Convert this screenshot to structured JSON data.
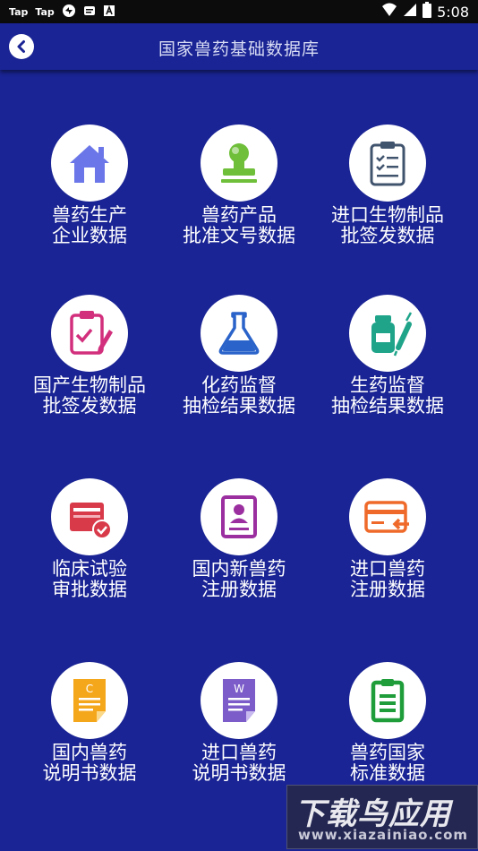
{
  "status_bar": {
    "app1": "Tap",
    "app2": "Tap",
    "time": "5:08"
  },
  "app_bar": {
    "title": "国家兽药基础数据库"
  },
  "tiles": [
    {
      "line1": "兽药生产",
      "line2": "企业数据",
      "icon": "house-icon",
      "color": "#6b77e8"
    },
    {
      "line1": "兽药产品",
      "line2": "批准文号数据",
      "icon": "stamp-icon",
      "color": "#6fbf3a"
    },
    {
      "line1": "进口生物制品",
      "line2": "批签发数据",
      "icon": "clipboard-checklist-icon",
      "color": "#41546e"
    },
    {
      "line1": "国产生物制品",
      "line2": "批签发数据",
      "icon": "clipboard-pen-icon",
      "color": "#d22f7d"
    },
    {
      "line1": "化药监督",
      "line2": "抽检结果数据",
      "icon": "flask-icon",
      "color": "#2a63c9"
    },
    {
      "line1": "生药监督",
      "line2": "抽检结果数据",
      "icon": "vial-syringe-icon",
      "color": "#1fa48a"
    },
    {
      "line1": "临床试验",
      "line2": "审批数据",
      "icon": "card-approved-icon",
      "color": "#d83a4a"
    },
    {
      "line1": "国内新兽药",
      "line2": "注册数据",
      "icon": "id-document-icon",
      "color": "#9b2fa0"
    },
    {
      "line1": "进口兽药",
      "line2": "注册数据",
      "icon": "card-import-icon",
      "color": "#ef6a2a"
    },
    {
      "line1": "国内兽药",
      "line2": "说明书数据",
      "icon": "document-c-icon",
      "color": "#f5a71c"
    },
    {
      "line1": "进口兽药",
      "line2": "说明书数据",
      "icon": "document-w-icon",
      "color": "#7b5cc9"
    },
    {
      "line1": "兽药国家",
      "line2": "标准数据",
      "icon": "clipboard-list-icon",
      "color": "#1f9d3a"
    }
  ],
  "watermark": {
    "main": "下载鸟应用",
    "sub": "www.xiazainiao.com"
  }
}
